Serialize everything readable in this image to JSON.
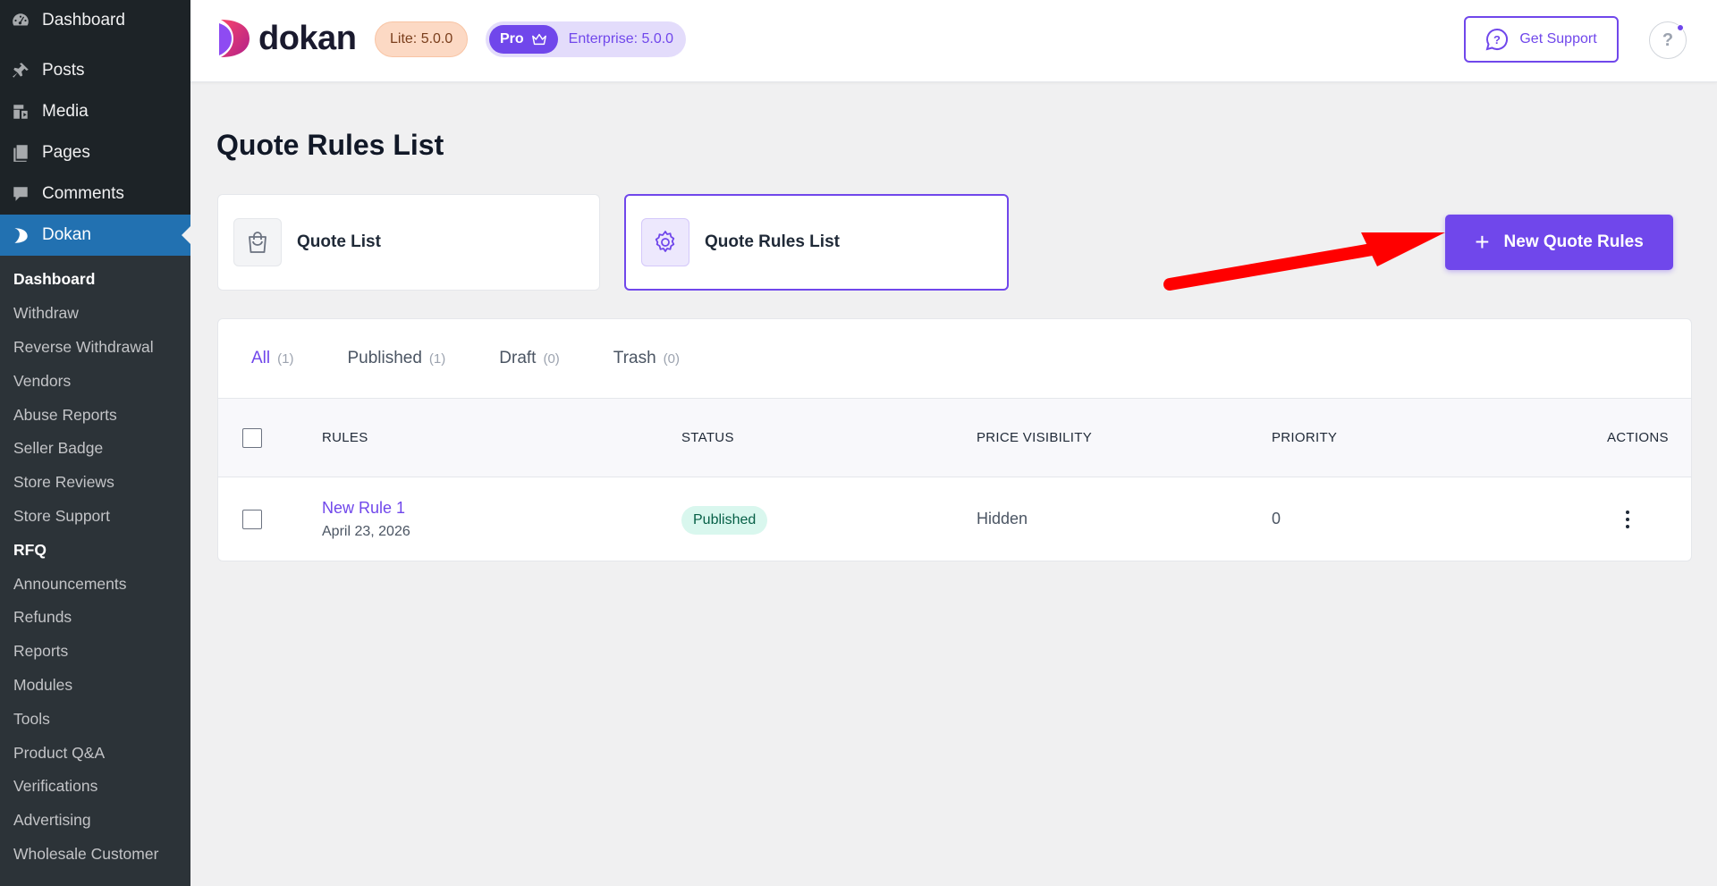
{
  "sidebar": {
    "top_items": [
      {
        "label": "Dashboard",
        "icon": "dashboard-icon"
      },
      {
        "label": "Posts",
        "icon": "pin-icon"
      },
      {
        "label": "Media",
        "icon": "media-icon"
      },
      {
        "label": "Pages",
        "icon": "pages-icon"
      },
      {
        "label": "Comments",
        "icon": "comment-icon"
      },
      {
        "label": "Dokan",
        "icon": "dokan-icon",
        "active": true
      }
    ],
    "submenu": [
      "Dashboard",
      "Withdraw",
      "Reverse Withdrawal",
      "Vendors",
      "Abuse Reports",
      "Seller Badge",
      "Store Reviews",
      "Store Support",
      "RFQ",
      "Announcements",
      "Refunds",
      "Reports",
      "Modules",
      "Tools",
      "Product Q&A",
      "Verifications",
      "Advertising",
      "Wholesale Customer"
    ],
    "submenu_bold": [
      "Dashboard",
      "RFQ"
    ]
  },
  "header": {
    "logo_text": "dokan",
    "lite_badge": "Lite: 5.0.0",
    "pro_label": "Pro",
    "enterprise_label": "Enterprise: 5.0.0",
    "support_label": "Get Support",
    "help_label": "?"
  },
  "main": {
    "title": "Quote Rules List",
    "tabs": [
      {
        "label": "Quote List",
        "icon": "shopping-bag-icon",
        "selected": false
      },
      {
        "label": "Quote Rules List",
        "icon": "gear-icon",
        "selected": true
      }
    ],
    "new_button_label": "New Quote Rules",
    "new_button_icon": "+",
    "filters": [
      {
        "label": "All",
        "count": "(1)",
        "active": true
      },
      {
        "label": "Published",
        "count": "(1)",
        "active": false
      },
      {
        "label": "Draft",
        "count": "(0)",
        "active": false
      },
      {
        "label": "Trash",
        "count": "(0)",
        "active": false
      }
    ],
    "table": {
      "columns": [
        "RULES",
        "STATUS",
        "PRICE VISIBILITY",
        "PRIORITY",
        "ACTIONS"
      ],
      "rows": [
        {
          "title": "New Rule 1",
          "date": "April 23, 2026",
          "status": "Published",
          "price_visibility": "Hidden",
          "priority": "0"
        }
      ]
    }
  },
  "colors": {
    "accent": "#7047eb",
    "wp_sidebar": "#1d2327",
    "wp_active": "#2271b1",
    "annotation_arrow": "#ff0000"
  }
}
